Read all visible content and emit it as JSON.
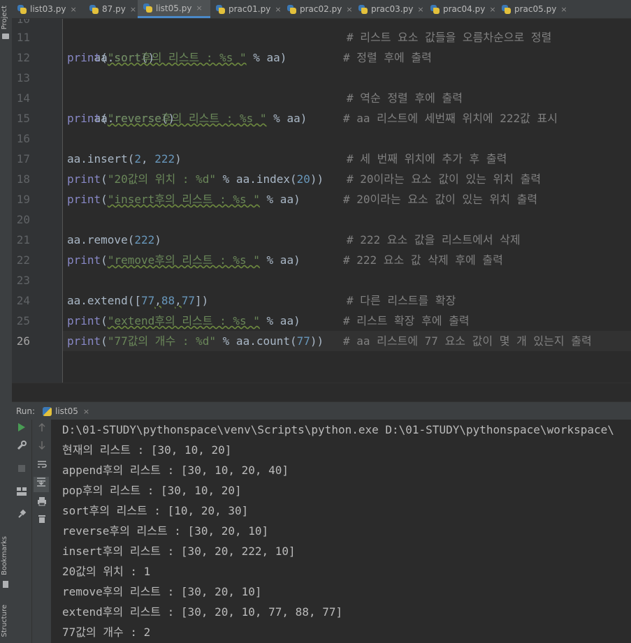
{
  "sidebar": {
    "project_label": "Project",
    "bookmarks_label": "Bookmarks",
    "structure_label": "Structure"
  },
  "tabs": [
    {
      "label": "list03.py",
      "active": false
    },
    {
      "label": "87.py",
      "active": false
    },
    {
      "label": "list05.py",
      "active": true
    },
    {
      "label": "prac01.py",
      "active": false
    },
    {
      "label": "prac02.py",
      "active": false
    },
    {
      "label": "prac03.py",
      "active": false
    },
    {
      "label": "prac04.py",
      "active": false
    },
    {
      "label": "prac05.py",
      "active": false
    }
  ],
  "tab_close_glyph": "×",
  "editor": {
    "line_numbers": [
      "10",
      "11",
      "12",
      "13",
      "14",
      "15",
      "16",
      "17",
      "18",
      "19",
      "20",
      "21",
      "22",
      "23",
      "24",
      "25",
      "26"
    ],
    "current_line": "26",
    "lines": {
      "l11": {
        "code": "aa.sort()",
        "comment": "# 리스트 요소 값들을 오름차순으로 정렬"
      },
      "l12": {
        "print": "print",
        "open": "(",
        "str": "\"sort후의 리스트 : %s \"",
        "rest": " % aa)",
        "comment": "# 정렬 후에 출력"
      },
      "l14": {
        "code": "aa.reverse()",
        "comment": "# 역순 정렬 후에 출력"
      },
      "l15": {
        "print": "print",
        "open": "(",
        "str": "\"reverse후의 리스트 : %s \"",
        "rest": " % aa)",
        "comment": "# aa 리스트에 세번째 위치에 222값 표시"
      },
      "l17": {
        "pre": "aa.insert(",
        "n1": "2",
        "sep": ", ",
        "n2": "222",
        "post": ")",
        "comment": "# 세 번째 위치에 추가 후 출력"
      },
      "l18": {
        "print": "print",
        "open": "(",
        "str": "\"20값의 위치 : %d\"",
        "mid": " % aa.index(",
        "num": "20",
        "post": "))",
        "comment": "# 20이라는 요소 값이 있는 위치 출력"
      },
      "l19": {
        "print": "print",
        "open": "(",
        "str": "\"insert후의 리스트 : %s \"",
        "rest": " % aa)",
        "comment": "# 20이라는 요소 값이 있는 위치 출력"
      },
      "l21": {
        "pre": "aa.remove(",
        "num": "222",
        "post": ")",
        "comment": "# 222 요소 값을 리스트에서 삭제"
      },
      "l22": {
        "print": "print",
        "open": "(",
        "str": "\"remove후의 리스트 : %s \"",
        "rest": " % aa)",
        "comment": "# 222 요소 값 삭제 후에 출력"
      },
      "l24": {
        "pre": "aa.extend([",
        "n1": "77",
        "c1": ",",
        "n2": "88",
        "c2": ",",
        "n3": "77",
        "post": "])",
        "comment": "# 다른 리스트를 확장"
      },
      "l25": {
        "print": "print",
        "open": "(",
        "str": "\"extend후의 리스트 : %s \"",
        "rest": " % aa)",
        "comment": "# 리스트 확장 후에 출력"
      },
      "l26": {
        "print": "print",
        "open": "(",
        "str": "\"77값의 개수 : %d\"",
        "mid": " % aa.count(",
        "num": "77",
        "post": "))",
        "comment": "# aa 리스트에 77 요소 값이 몇 개 있는지 출력"
      }
    }
  },
  "run": {
    "label": "Run:",
    "config_name": "list05",
    "output": [
      "D:\\01-STUDY\\pythonspace\\venv\\Scripts\\python.exe D:\\01-STUDY\\pythonspace\\workspace\\",
      "현재의 리스트 : [30, 10, 20]",
      "append후의 리스트 : [30, 10, 20, 40]",
      "pop후의 리스트 : [30, 10, 20]",
      "sort후의 리스트 : [10, 20, 30]",
      "reverse후의 리스트 : [30, 20, 10]",
      "insert후의 리스트 : [30, 20, 222, 10]",
      "20값의 위치 : 1",
      "remove후의 리스트 : [30, 20, 10]",
      "extend후의 리스트 : [30, 20, 10, 77, 88, 77]",
      "77값의 개수 : 2"
    ]
  },
  "colors": {
    "background": "#2b2b2b",
    "string": "#6a8759",
    "number": "#6897bb",
    "comment": "#808080",
    "builtin": "#8888c6",
    "accent": "#4a88c7"
  },
  "icons": [
    "python-file-icon",
    "run-icon",
    "wrench-icon",
    "stop-icon",
    "layout-icon",
    "pin-icon",
    "arrow-up-icon",
    "arrow-down-icon",
    "soft-wrap-icon",
    "scroll-to-end-icon",
    "print-icon",
    "trash-icon",
    "folder-icon",
    "bookmark-icon"
  ]
}
